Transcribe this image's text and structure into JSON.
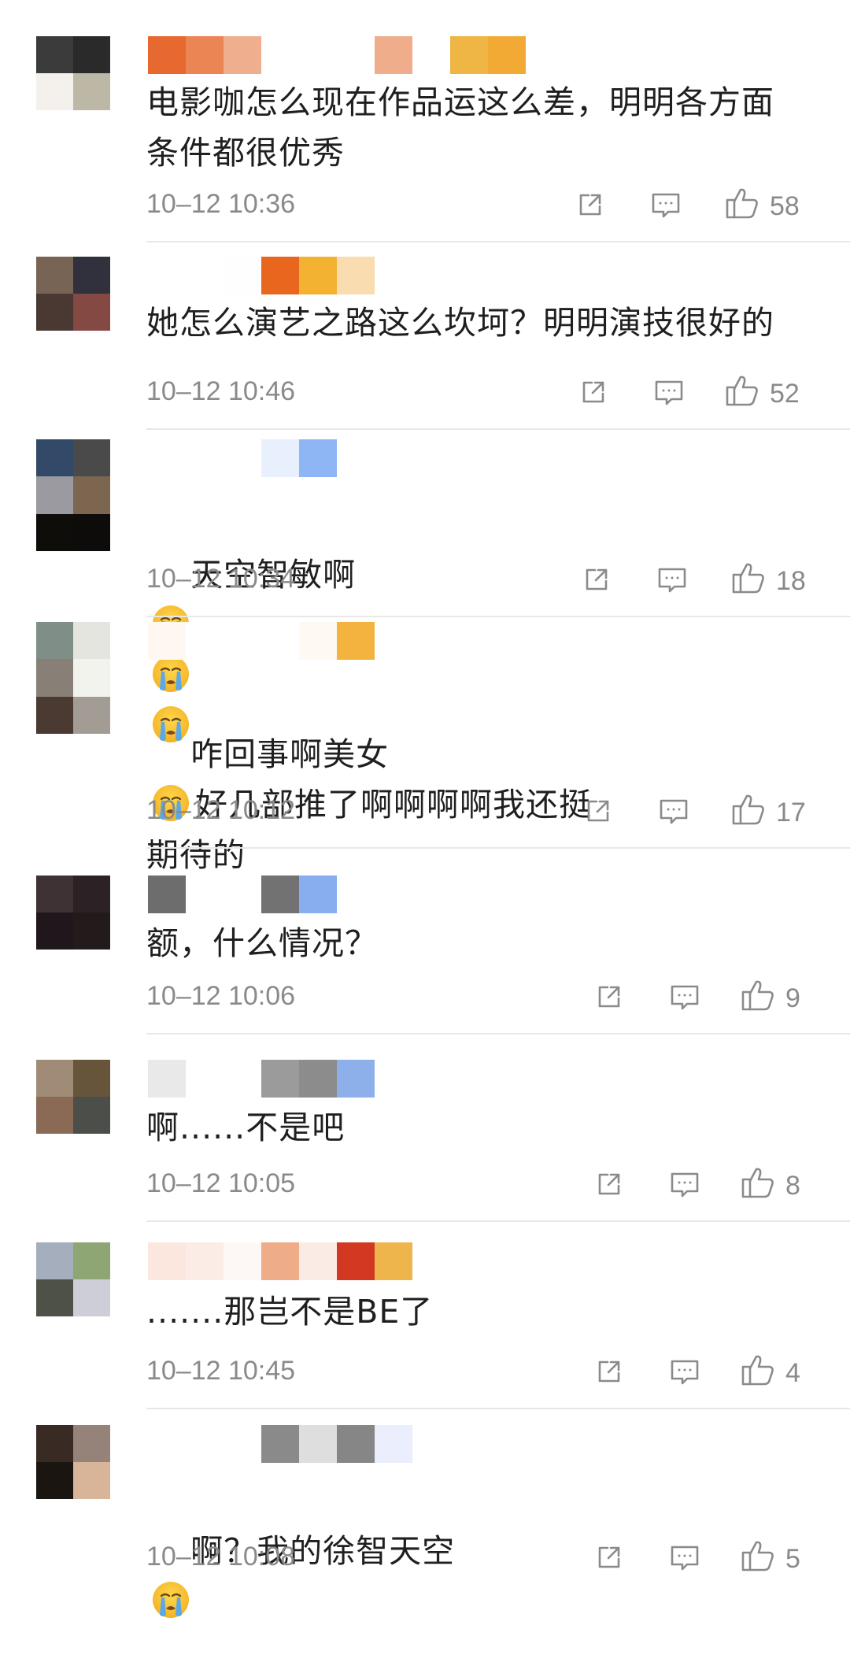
{
  "comments": [
    {
      "text": "电影咖怎么现在作品运这么差，明明各方面\n条件都很优秀",
      "time": "10–12 10:36",
      "likes": "58",
      "avatar_colors": [
        "#3b3b3b",
        "#2a2a2a",
        "#f4f1ec",
        "#bdb8a6"
      ],
      "name_colors": [
        "#e7692f",
        "#eb8553",
        "#efaf8f",
        "#ffffff",
        "#ffffff",
        "#ffffff",
        "#f0ad8c",
        "#ffffff",
        "#efb545",
        "#f3aa35"
      ]
    },
    {
      "text": "她怎么演艺之路这么坎坷？明明演技很好的",
      "time": "10–12 10:46",
      "likes": "52",
      "avatar_colors": [
        "#786455",
        "#30313d",
        "#4a3833",
        "#834942"
      ],
      "name_colors": [
        "#ffffff",
        "#ffffff",
        "#fefefe",
        "#e9661f",
        "#f4b233",
        "#f9ddb0"
      ]
    },
    {
      "text": "天空智敏啊",
      "time": "10–12 10:34",
      "likes": "18",
      "emoji_count": 3,
      "avatar_colors": [
        "#324a67",
        "#4a4a4a",
        "#9a9aa0",
        "#7c6650",
        "#0f0d0a",
        "#0e0c0a"
      ],
      "name_colors": [
        "#ffffff",
        "#ffffff",
        "#ffffff",
        "#e8effd",
        "#8fb6f4"
      ]
    },
    {
      "text": "咋回事啊美女",
      "text_after": "好几部推了啊啊啊啊我还挺\n期待的",
      "time": "10–12 10:12",
      "likes": "17",
      "emoji_count": 1,
      "avatar_colors": [
        "#7f8e86",
        "#e3e5de",
        "#888077",
        "#f3f3ee",
        "#4a3a31",
        "#a39c95"
      ],
      "name_colors": [
        "#fff7f1",
        "#ffffff",
        "#ffffff",
        "#ffffff",
        "#fff9f3",
        "#f4b23e"
      ]
    },
    {
      "text": "额，什么情况？",
      "time": "10–12 10:06",
      "likes": "9",
      "avatar_colors": [
        "#3f3234",
        "#2c2125",
        "#1f171b",
        "#231a1c"
      ],
      "name_colors": [
        "#6d6d6d",
        "#ffffff",
        "#ffffff",
        "#727272",
        "#89aef0",
        "#ffffff"
      ]
    },
    {
      "text": "啊......不是吧",
      "time": "10–12 10:05",
      "likes": "8",
      "avatar_colors": [
        "#a08b77",
        "#66553a",
        "#8a6a55",
        "#4b4e49"
      ],
      "name_colors": [
        "#e9e9e9",
        "#ffffff",
        "#ffffff",
        "#9b9b9b",
        "#8c8c8c",
        "#8db0ea"
      ]
    },
    {
      "text": ".......那岂不是BE了",
      "time": "10–12 10:45",
      "likes": "4",
      "avatar_colors": [
        "#a5aebd",
        "#8ea574",
        "#4d5148",
        "#cdced8"
      ],
      "name_colors": [
        "#fbe7dd",
        "#fbece5",
        "#fdf8f5",
        "#efac88",
        "#fbebe5",
        "#d33822",
        "#efb54d"
      ]
    },
    {
      "text": "啊？我的徐智天空",
      "time": "10–12 10:08",
      "likes": "5",
      "emoji_count": 1,
      "avatar_colors": [
        "#3a2a24",
        "#958278",
        "#1a1511",
        "#d8b599"
      ],
      "name_colors": [
        "#ffffff",
        "#ffffff",
        "#ffffff",
        "#8a8a8a",
        "#dedede",
        "#868686",
        "#ebeefc"
      ]
    }
  ]
}
